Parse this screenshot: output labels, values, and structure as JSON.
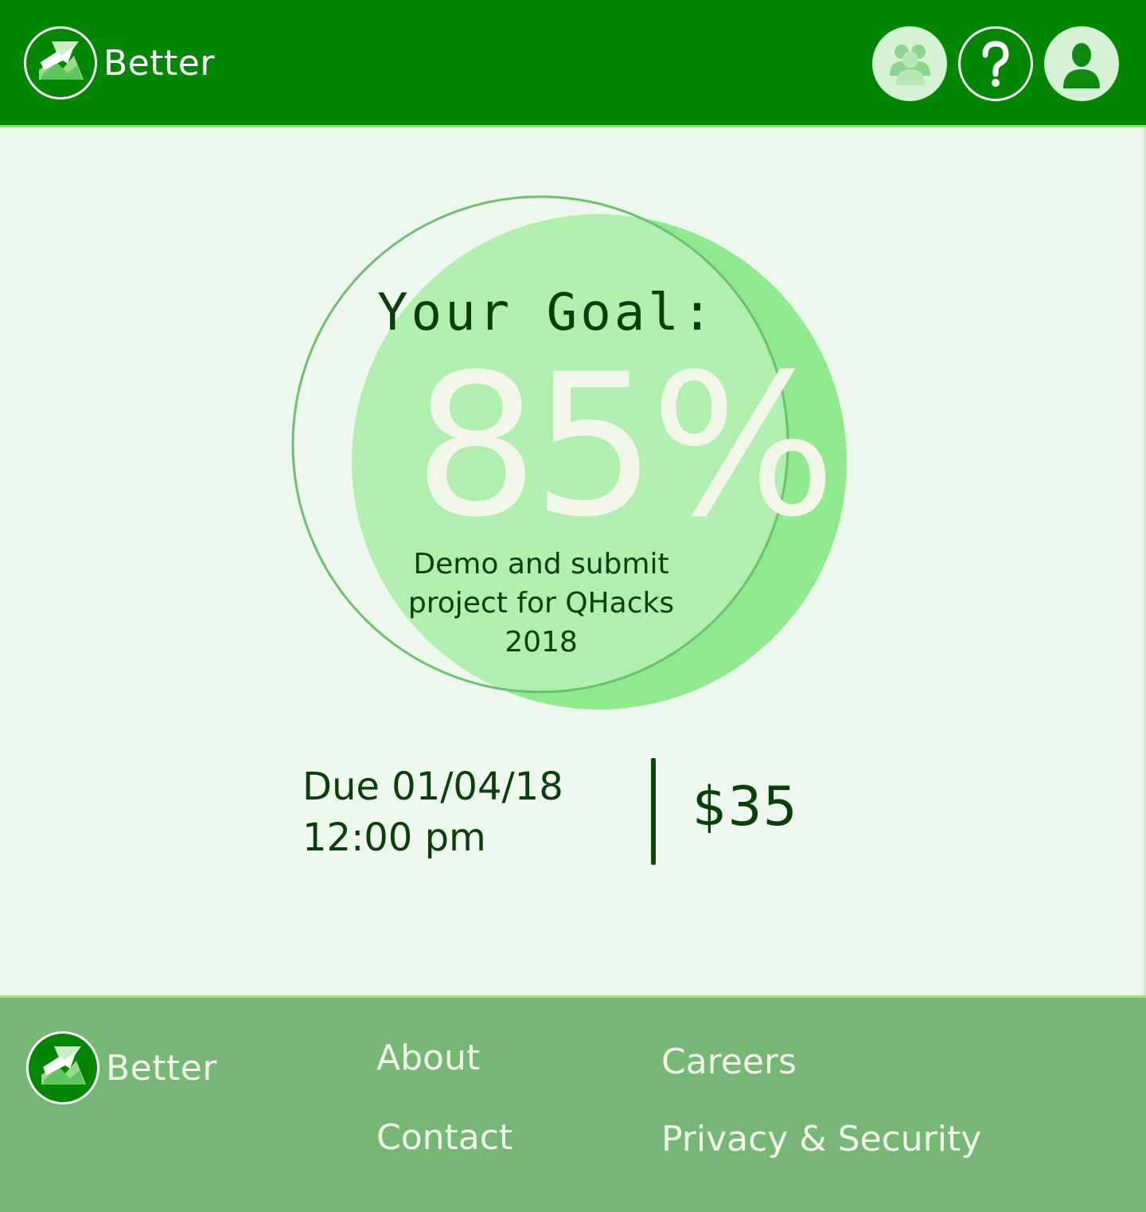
{
  "brand": {
    "name": "Better",
    "primary_color": "#008600",
    "accent_color": "#8ee36a",
    "icon": "better-logo-icon"
  },
  "header": {
    "icons": [
      {
        "name": "group-icon",
        "label": "Groups"
      },
      {
        "name": "help-icon",
        "label": "Help"
      },
      {
        "name": "profile-icon",
        "label": "Profile"
      }
    ]
  },
  "goal": {
    "title": "Your Goal:",
    "percent": "85%",
    "progress_fraction": 0.85,
    "description": "Demo and submit project for QHacks 2018",
    "due_date_line": "Due 01/04/18",
    "due_time_line": "12:00 pm",
    "amount": "$35"
  },
  "footer": {
    "brand": "Better",
    "links": {
      "about": "About",
      "contact": "Contact",
      "careers": "Careers",
      "privacy": "Privacy & Security"
    }
  }
}
